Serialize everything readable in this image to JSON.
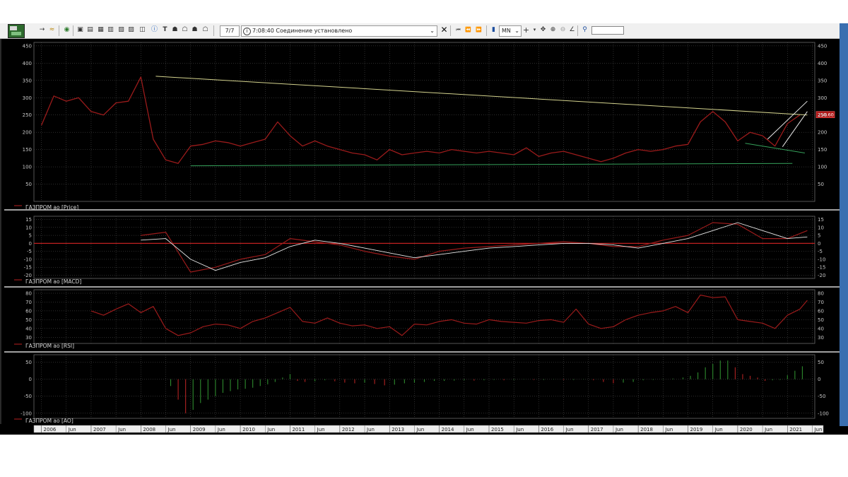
{
  "toolbar": {
    "counter": "7/7",
    "status": "7:08:40  Соединение установлено",
    "timeframe": "MN"
  },
  "colors": {
    "price": "#9b1b1b",
    "signal": "#e8e8e8",
    "trend_resistance": "#d4d38e",
    "trend_support": "#35a05a",
    "ao_up": "#2e8b2e",
    "ao_down": "#b22222",
    "background": "#000000",
    "grid": "#5a5a5a"
  },
  "price_tag": "250.60",
  "chart_data": [
    {
      "type": "line",
      "legend": "ГАЗПРОМ ао [Price]",
      "ylim": [
        0,
        460
      ],
      "yticks": [
        50,
        100,
        150,
        200,
        250,
        300,
        350,
        400,
        450
      ],
      "x": [
        2006.0,
        2006.25,
        2006.5,
        2006.75,
        2007.0,
        2007.25,
        2007.5,
        2007.75,
        2008.0,
        2008.25,
        2008.5,
        2008.75,
        2009.0,
        2009.25,
        2009.5,
        2009.75,
        2010.0,
        2010.25,
        2010.5,
        2010.75,
        2011.0,
        2011.25,
        2011.5,
        2011.75,
        2012.0,
        2012.25,
        2012.5,
        2012.75,
        2013.0,
        2013.25,
        2013.5,
        2013.75,
        2014.0,
        2014.25,
        2014.5,
        2014.75,
        2015.0,
        2015.25,
        2015.5,
        2015.75,
        2016.0,
        2016.25,
        2016.5,
        2016.75,
        2017.0,
        2017.25,
        2017.5,
        2017.75,
        2018.0,
        2018.25,
        2018.5,
        2018.75,
        2019.0,
        2019.25,
        2019.5,
        2019.75,
        2020.0,
        2020.25,
        2020.5,
        2020.75,
        2021.0,
        2021.25
      ],
      "values": [
        220,
        305,
        290,
        300,
        260,
        250,
        285,
        290,
        360,
        180,
        120,
        110,
        160,
        165,
        175,
        170,
        160,
        170,
        180,
        230,
        190,
        160,
        175,
        160,
        150,
        140,
        135,
        120,
        150,
        135,
        140,
        145,
        140,
        150,
        145,
        140,
        145,
        140,
        135,
        155,
        130,
        140,
        145,
        135,
        125,
        115,
        125,
        140,
        150,
        145,
        150,
        160,
        165,
        230,
        260,
        230,
        175,
        200,
        190,
        160,
        225,
        250
      ],
      "series": [
        {
          "name": "trend_resistance",
          "x": [
            2008.3,
            2021.4
          ],
          "values": [
            362,
            250
          ]
        },
        {
          "name": "trend_support",
          "x": [
            2009.0,
            2021.1
          ],
          "values": [
            103,
            110
          ]
        },
        {
          "name": "support_recent",
          "x": [
            2020.15,
            2021.35
          ],
          "values": [
            168,
            140
          ]
        },
        {
          "name": "channel_a",
          "x": [
            2020.6,
            2021.4
          ],
          "values": [
            180,
            290
          ]
        },
        {
          "name": "channel_b",
          "x": [
            2020.9,
            2021.4
          ],
          "values": [
            158,
            260
          ]
        }
      ]
    },
    {
      "type": "line",
      "legend": "ГАЗПРОМ ао [MACD]",
      "ylim": [
        -22,
        17
      ],
      "yticks": [
        -20,
        -15,
        -10,
        -5,
        0,
        5,
        10,
        15
      ],
      "x": [
        2008.0,
        2008.5,
        2009.0,
        2009.5,
        2010.0,
        2010.5,
        2011.0,
        2011.5,
        2012.0,
        2012.5,
        2013.0,
        2013.5,
        2014.0,
        2014.5,
        2015.0,
        2015.5,
        2016.0,
        2016.5,
        2017.0,
        2017.5,
        2018.0,
        2018.5,
        2019.0,
        2019.5,
        2020.0,
        2020.5,
        2021.0,
        2021.4
      ],
      "series": [
        {
          "name": "macd",
          "values": [
            5,
            7,
            -18,
            -15,
            -10,
            -7,
            3,
            1,
            -1,
            -5,
            -8,
            -10,
            -5,
            -3,
            -2,
            -1,
            0,
            1,
            0,
            -2,
            -2,
            2,
            5,
            13,
            12,
            3,
            3,
            8
          ]
        },
        {
          "name": "signal",
          "values": [
            2,
            3,
            -10,
            -17,
            -12,
            -9,
            -2,
            2,
            0,
            -3,
            -6,
            -9,
            -7,
            -5,
            -3,
            -2,
            -1,
            0,
            0,
            -1,
            -3,
            0,
            3,
            8,
            13,
            8,
            3,
            4
          ]
        }
      ]
    },
    {
      "type": "line",
      "legend": "ГАЗПРОМ ао [RSI]",
      "ylim": [
        23,
        84
      ],
      "yticks": [
        30,
        40,
        50,
        60,
        70,
        80
      ],
      "x": [
        2007.0,
        2007.25,
        2007.5,
        2007.75,
        2008.0,
        2008.25,
        2008.5,
        2008.75,
        2009.0,
        2009.25,
        2009.5,
        2009.75,
        2010.0,
        2010.25,
        2010.5,
        2010.75,
        2011.0,
        2011.25,
        2011.5,
        2011.75,
        2012.0,
        2012.25,
        2012.5,
        2012.75,
        2013.0,
        2013.25,
        2013.5,
        2013.75,
        2014.0,
        2014.25,
        2014.5,
        2014.75,
        2015.0,
        2015.25,
        2015.5,
        2015.75,
        2016.0,
        2016.25,
        2016.5,
        2016.75,
        2017.0,
        2017.25,
        2017.5,
        2017.75,
        2018.0,
        2018.25,
        2018.5,
        2018.75,
        2019.0,
        2019.25,
        2019.5,
        2019.75,
        2020.0,
        2020.25,
        2020.5,
        2020.75,
        2021.0,
        2021.25,
        2021.4
      ],
      "values": [
        60,
        55,
        62,
        68,
        58,
        65,
        40,
        32,
        35,
        42,
        45,
        44,
        40,
        48,
        52,
        58,
        64,
        48,
        46,
        52,
        46,
        43,
        44,
        40,
        42,
        32,
        45,
        44,
        48,
        50,
        46,
        45,
        50,
        48,
        47,
        46,
        49,
        50,
        47,
        62,
        45,
        40,
        42,
        50,
        55,
        58,
        60,
        65,
        58,
        78,
        75,
        76,
        50,
        48,
        46,
        40,
        55,
        62,
        72
      ]
    },
    {
      "type": "bar",
      "legend": "ГАЗПРОМ ао [AO]",
      "ylim": [
        -115,
        72
      ],
      "yticks": [
        -100,
        -50,
        0,
        50
      ],
      "x": [
        2008.6,
        2008.75,
        2008.9,
        2009.05,
        2009.2,
        2009.35,
        2009.5,
        2009.65,
        2009.8,
        2009.95,
        2010.1,
        2010.25,
        2010.4,
        2010.55,
        2010.7,
        2010.85,
        2011.0,
        2011.15,
        2011.3,
        2011.5,
        2011.7,
        2011.9,
        2012.1,
        2012.3,
        2012.5,
        2012.7,
        2012.9,
        2013.1,
        2013.3,
        2013.5,
        2013.7,
        2013.9,
        2014.1,
        2014.3,
        2014.5,
        2014.7,
        2014.9,
        2015.1,
        2015.3,
        2015.5,
        2015.7,
        2015.9,
        2016.1,
        2016.3,
        2016.5,
        2016.7,
        2016.9,
        2017.1,
        2017.3,
        2017.5,
        2017.7,
        2017.9,
        2018.1,
        2018.3,
        2018.5,
        2018.7,
        2018.9,
        2019.05,
        2019.2,
        2019.35,
        2019.5,
        2019.65,
        2019.8,
        2019.95,
        2020.1,
        2020.25,
        2020.4,
        2020.55,
        2020.7,
        2020.85,
        2021.0,
        2021.15,
        2021.3
      ],
      "values": [
        -20,
        -60,
        -100,
        -90,
        -70,
        -60,
        -50,
        -40,
        -35,
        -30,
        -28,
        -25,
        -20,
        -15,
        -8,
        5,
        15,
        -5,
        -8,
        -6,
        -3,
        -6,
        -10,
        -12,
        -10,
        -14,
        -18,
        -16,
        -12,
        -10,
        -8,
        -5,
        -5,
        -4,
        -3,
        -4,
        -3,
        -2,
        -3,
        -2,
        -1,
        -2,
        -2,
        -1,
        -2,
        -2,
        -1,
        -3,
        -8,
        -12,
        -10,
        -8,
        -3,
        -2,
        -1,
        2,
        5,
        10,
        20,
        35,
        45,
        55,
        55,
        35,
        15,
        10,
        5,
        -5,
        -3,
        -2,
        12,
        25,
        38
      ]
    }
  ],
  "x_axis": {
    "years": [
      "2006",
      "2007",
      "2008",
      "2009",
      "2010",
      "2011",
      "2012",
      "2013",
      "2014",
      "2015",
      "2016",
      "2017",
      "2018",
      "2019",
      "2020",
      "2021"
    ],
    "half_label": "Jun"
  }
}
